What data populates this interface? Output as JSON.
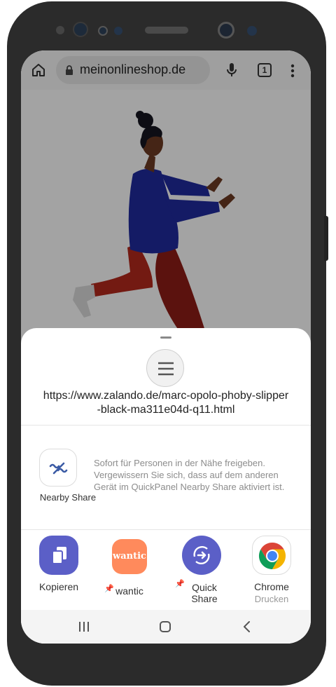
{
  "browser": {
    "url": "meinonlineshop.de",
    "tab_count": "1"
  },
  "share_sheet": {
    "shared_url_line1": "https://www.zalando.de/marc-opolo-phoby-slipper",
    "shared_url_line2": "-black-ma311e04d-q11.html",
    "nearby": {
      "label": "Nearby Share",
      "description": "Sofort für Personen in der Nähe freigeben. Vergewissern Sie sich, dass auf dem anderen Gerät im QuickPanel Nearby Share aktiviert ist."
    },
    "apps": [
      {
        "label": "Kopieren",
        "icon": "copy-icon"
      },
      {
        "label": "wantic",
        "icon": "wantic-logo",
        "logo_text": "wantic",
        "pinned": true
      },
      {
        "label_line1": "Quick",
        "label_line2": "Share",
        "icon": "quick-share-icon",
        "pinned": true
      },
      {
        "label": "Chrome",
        "sub": "Drucken",
        "icon": "chrome-icon"
      }
    ]
  },
  "colors": {
    "accent": "#5b5fc7",
    "wantic": "#ff8a5c",
    "chrome_red": "#db4437",
    "chrome_yellow": "#f4b400",
    "chrome_green": "#0f9d58",
    "chrome_blue": "#4285f4"
  }
}
